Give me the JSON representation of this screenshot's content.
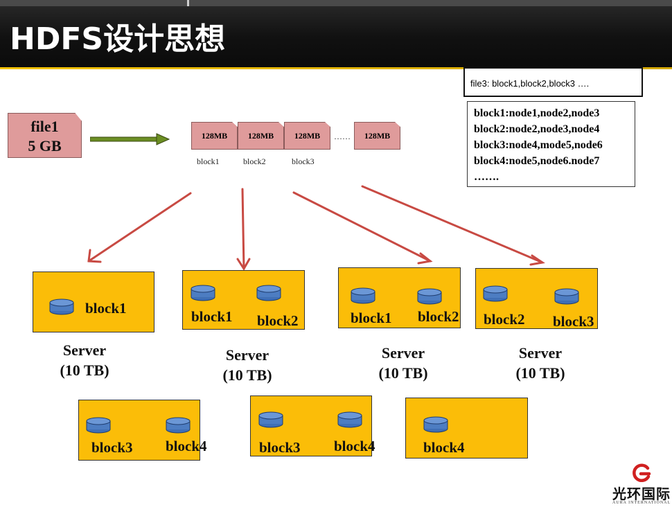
{
  "title": "HDFS设计思想",
  "file": {
    "name": "file1",
    "size": "5 GB"
  },
  "block_cells": [
    "128MB",
    "128MB",
    "128MB",
    "128MB"
  ],
  "block_labels": [
    "block1",
    "block2",
    "block3"
  ],
  "small_dots": "……",
  "metadata": {
    "file_line": "file3: block1,block2,block3 ….",
    "lines": [
      "block1:node1,node2,node3",
      "block2:node2,node3,node4",
      "block3:node4,mode5,node6",
      "block4:node5,node6.node7",
      "……."
    ]
  },
  "servers": [
    {
      "blocks": [
        "block1"
      ],
      "caption": [
        "Server",
        "(10 TB)"
      ]
    },
    {
      "blocks": [
        "block1",
        "block2"
      ],
      "caption": [
        "Server",
        "(10 TB)"
      ]
    },
    {
      "blocks": [
        "block1",
        "block2"
      ],
      "caption": [
        "Server",
        "(10 TB)"
      ]
    },
    {
      "blocks": [
        "block2",
        "block3"
      ],
      "caption": [
        "Server",
        "(10 TB)"
      ]
    },
    {
      "blocks": [
        "block3",
        "block4"
      ]
    },
    {
      "blocks": [
        "block3",
        "block4"
      ]
    },
    {
      "blocks": [
        "block4"
      ]
    }
  ],
  "logo": {
    "name": "光环国际",
    "sub": "AURA INTERNATIONAL"
  },
  "colors": {
    "server": "#fbbd08",
    "file": "#df9b9b",
    "arrow_red": "#c84a43",
    "arrow_green": "#5a7a1a",
    "disk": "#4d7dc2"
  }
}
